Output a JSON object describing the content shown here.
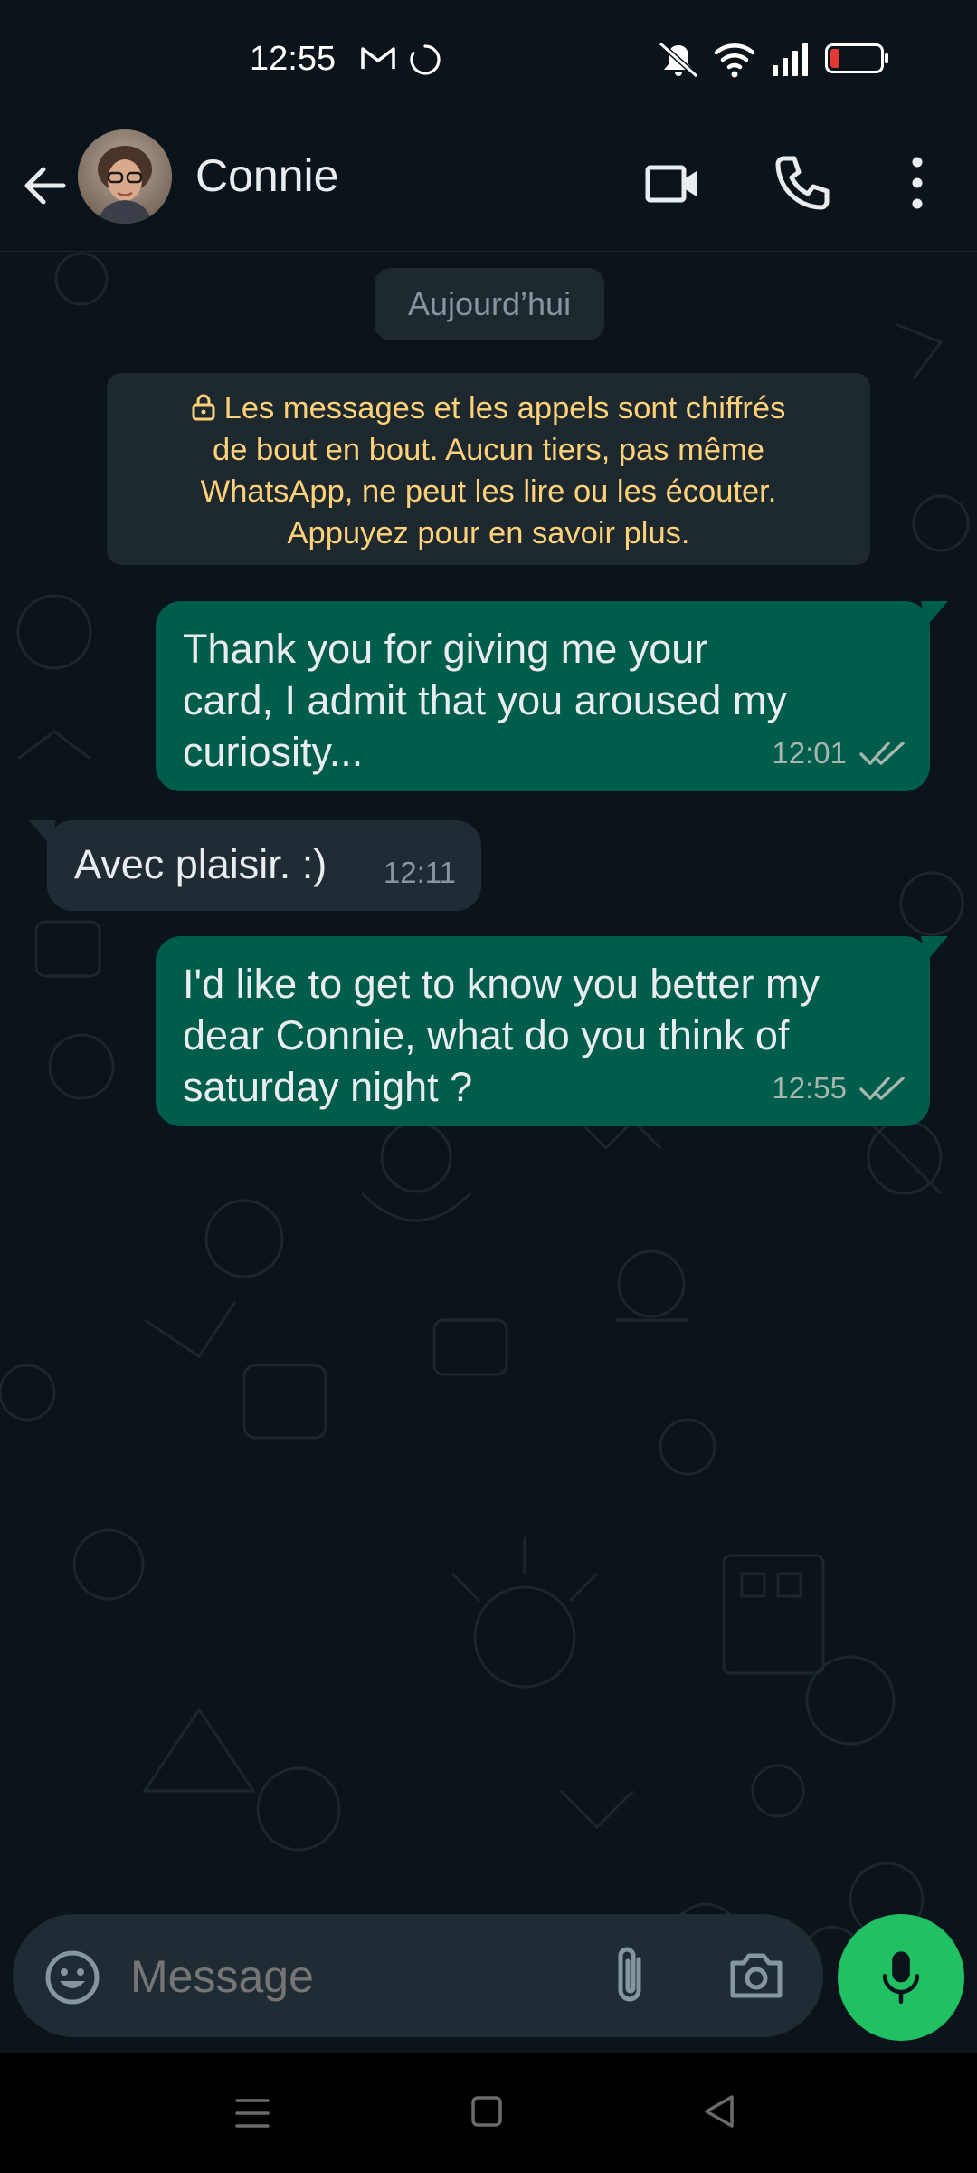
{
  "status_bar": {
    "time": "12:55",
    "icons": [
      "gmail-icon",
      "sync-icon",
      "mute-icon",
      "wifi-icon",
      "signal-icon",
      "battery-low-icon"
    ]
  },
  "header": {
    "contact_name": "Connie"
  },
  "chat": {
    "date_label": "Aujourd’hui",
    "encryption_notice": "Les messages et les appels sont chiffrés\nde bout en bout. Aucun tiers, pas même\nWhatsApp, ne peut les lire ou les écouter.\nAppuyez pour en savoir plus.",
    "messages": [
      {
        "direction": "outgoing",
        "text": "Thank you for giving me your\ncard, I admit that you aroused my\ncuriosity...",
        "time": "12:01",
        "status": "read"
      },
      {
        "direction": "incoming",
        "text": "Avec plaisir. :)",
        "time": "12:11"
      },
      {
        "direction": "outgoing",
        "text": "I'd like to get to know you better my\ndear Connie, what do you think of\nsaturday night ?",
        "time": "12:55",
        "status": "read"
      }
    ]
  },
  "composer": {
    "placeholder": "Message"
  },
  "colors": {
    "background": "#0b141a",
    "outgoing_bubble": "#005c4b",
    "incoming_bubble": "#1f2c34",
    "accent": "#21c063",
    "notice_text": "#ffd279"
  }
}
